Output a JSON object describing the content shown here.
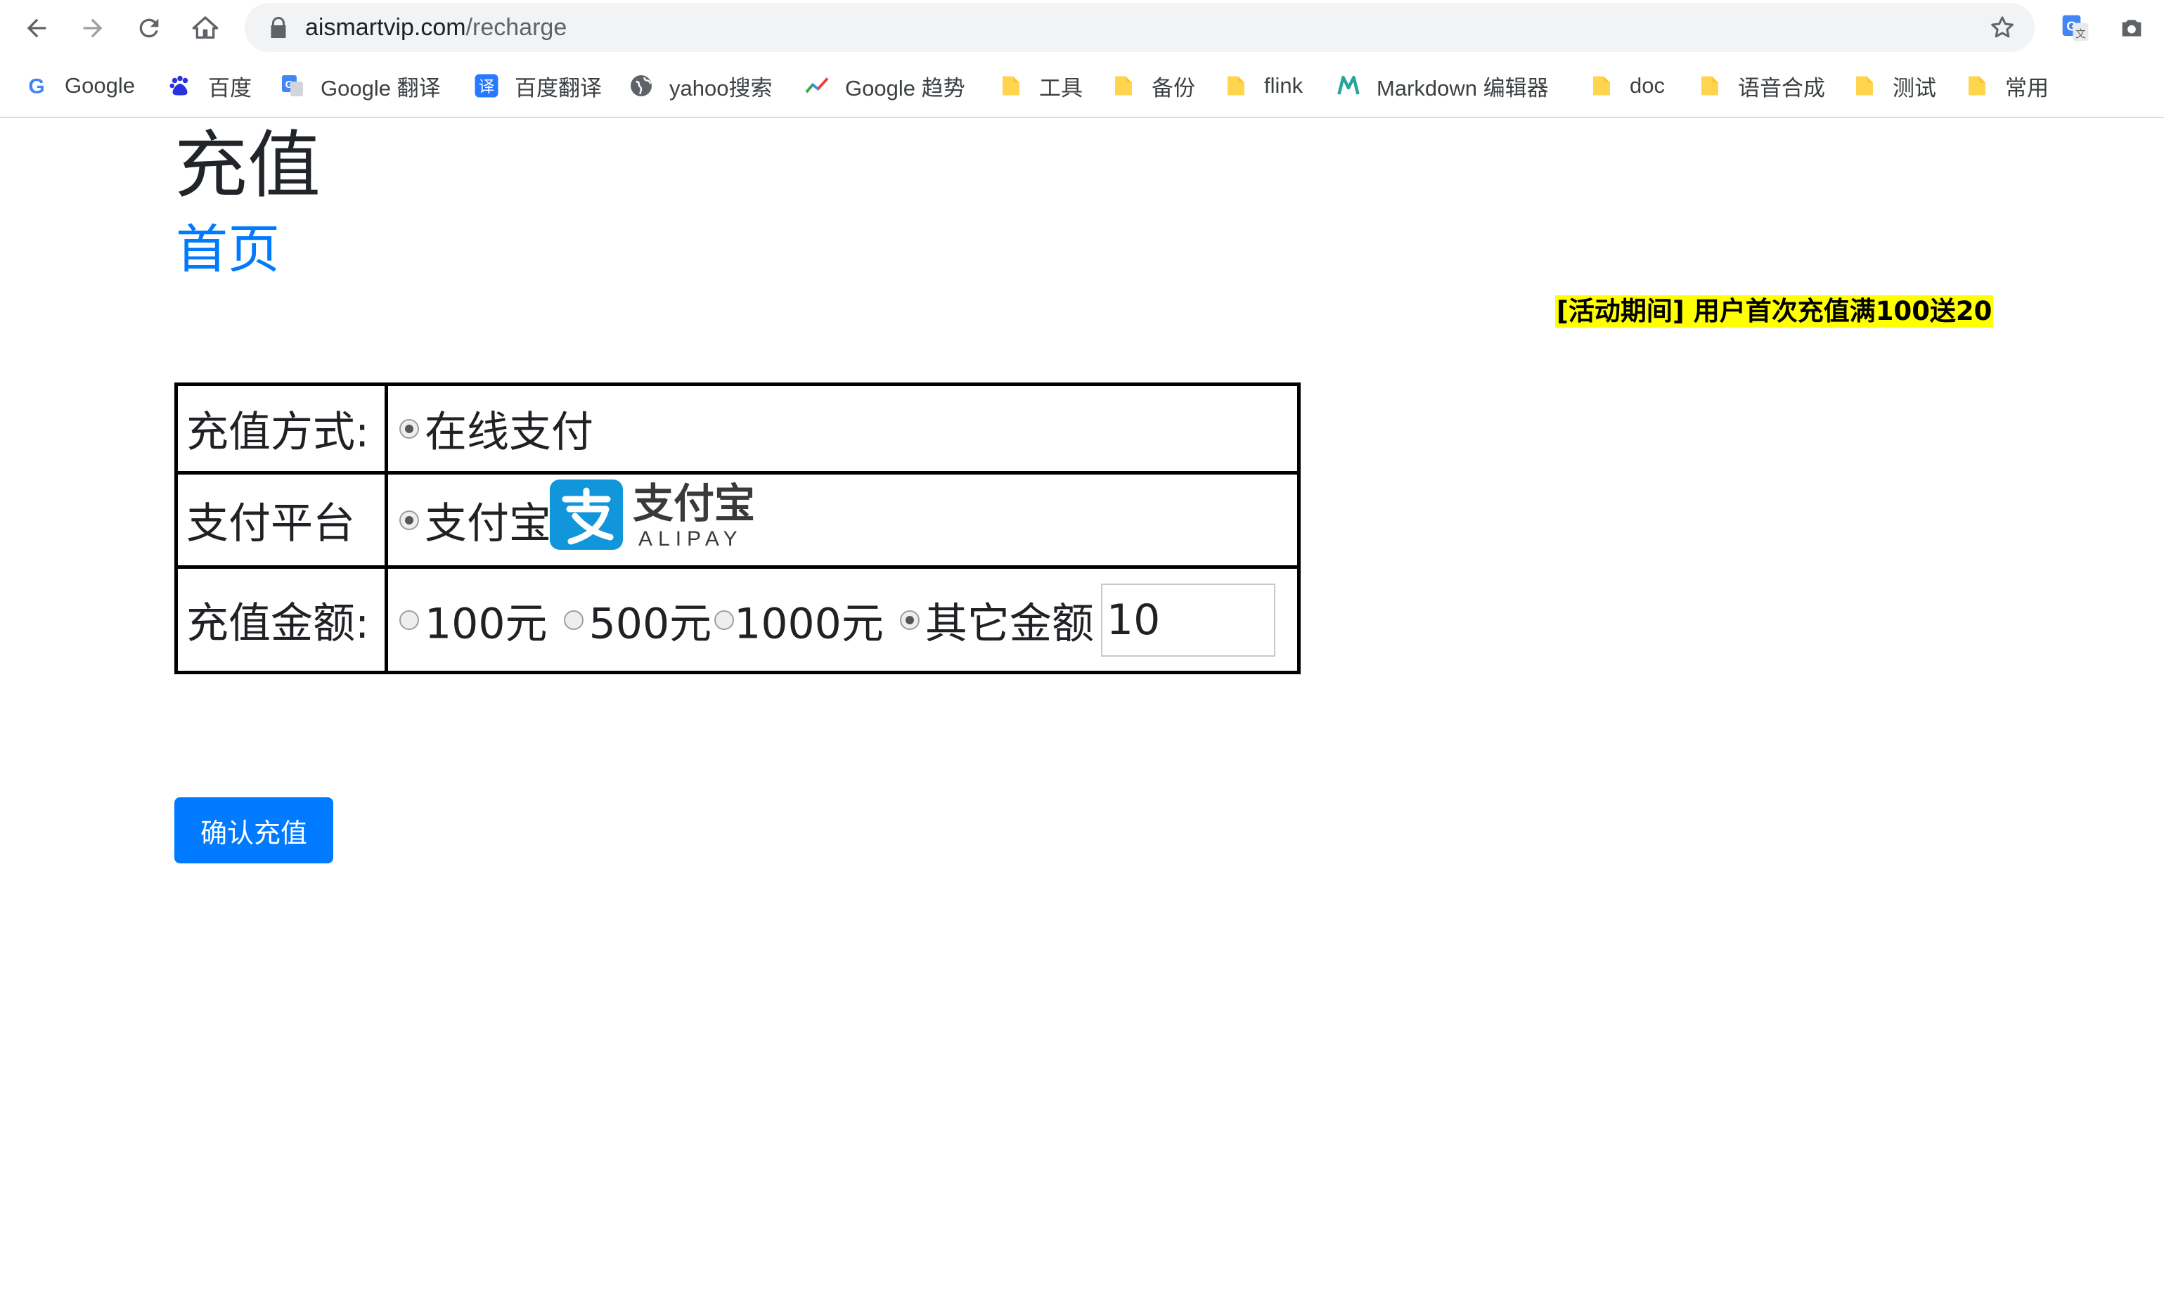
{
  "browser": {
    "url_host": "aismartvip.com",
    "url_path": "/recharge",
    "bookmarks": [
      {
        "label": "Google",
        "icon": "google-icon"
      },
      {
        "label": "百度",
        "icon": "baidu-paw-icon"
      },
      {
        "label": "Google 翻译",
        "icon": "google-translate-icon"
      },
      {
        "label": "百度翻译",
        "icon": "baidu-translate-icon"
      },
      {
        "label": "yahoo搜索",
        "icon": "globe-icon"
      },
      {
        "label": "Google 趋势",
        "icon": "trends-icon"
      },
      {
        "label": "工具",
        "icon": "folder-icon"
      },
      {
        "label": "备份",
        "icon": "folder-icon"
      },
      {
        "label": "flink",
        "icon": "folder-icon"
      },
      {
        "label": "Markdown 编辑器",
        "icon": "markdown-icon"
      },
      {
        "label": "doc",
        "icon": "folder-icon"
      },
      {
        "label": "语音合成",
        "icon": "folder-icon"
      },
      {
        "label": "测试",
        "icon": "folder-icon"
      },
      {
        "label": "常用",
        "icon": "folder-icon"
      }
    ]
  },
  "page": {
    "title": "充值",
    "home_link": "首页",
    "promo": "[活动期间]  用户首次充值满100送20"
  },
  "form": {
    "method_label": "充值方式:",
    "method_option": "在线支付",
    "platform_label": "支付平台",
    "platform_option": "支付宝",
    "alipay_logo_text": "支付宝",
    "alipay_logo_sub": "ALIPAY",
    "amount_label": "充值金额:",
    "amount_options": [
      "100元",
      "500元",
      "1000元",
      "其它金额"
    ],
    "amount_selected": "其它金额",
    "custom_amount": "10"
  },
  "actions": {
    "confirm_label": "确认充值"
  },
  "colors": {
    "primary": "#007bff",
    "promo_bg": "#ffff00",
    "alipay_blue": "#1296db",
    "folder_yellow": "#ffd54f"
  }
}
